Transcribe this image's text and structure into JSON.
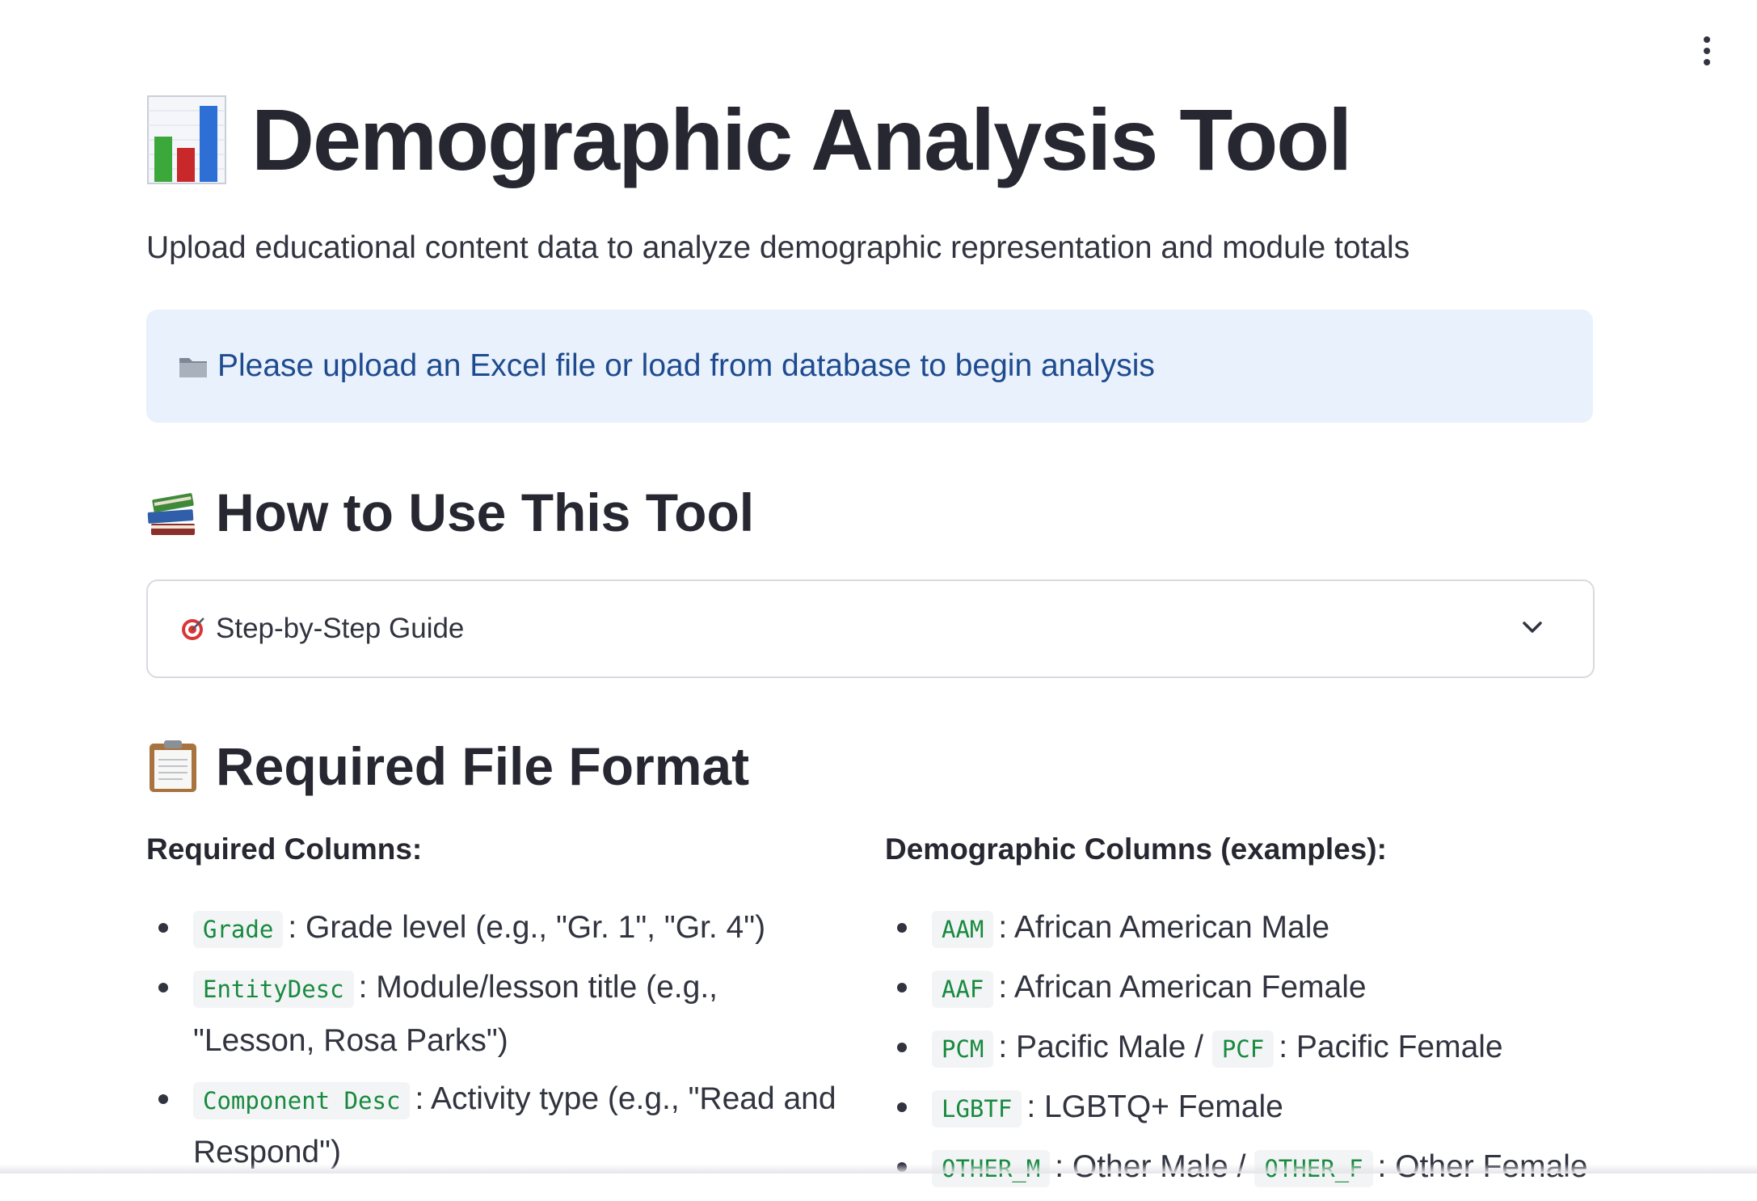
{
  "header": {
    "title": "Demographic Analysis Tool",
    "title_icon": "bar-chart-icon",
    "subtitle": "Upload educational content data to analyze demographic representation and module totals"
  },
  "info_box": {
    "icon": "folder-icon",
    "message": "Please upload an Excel file or load from database to begin analysis"
  },
  "how_to": {
    "icon": "books-icon",
    "heading": "How to Use This Tool",
    "expander": {
      "icon": "target-icon",
      "label": "Step-by-Step Guide"
    }
  },
  "file_format": {
    "icon": "clipboard-icon",
    "heading": "Required File Format",
    "required_columns": {
      "heading": "Required Columns:",
      "items": [
        {
          "code": "Grade",
          "text": ": Grade level (e.g., \"Gr. 1\", \"Gr. 4\")"
        },
        {
          "code": "EntityDesc",
          "text": ": Module/lesson title (e.g., \"Lesson, Rosa Parks\")"
        },
        {
          "code": "Component Desc",
          "text": ": Activity type (e.g., \"Read and Respond\")"
        }
      ]
    },
    "demographic_columns": {
      "heading": "Demographic Columns (examples):",
      "items": [
        {
          "code": "AAM",
          "text": ": African American Male"
        },
        {
          "code": "AAF",
          "text": ": African American Female"
        },
        {
          "code": "PCM",
          "text": ": Pacific Male / ",
          "code2": "PCF",
          "text2": ": Pacific Female"
        },
        {
          "code": "LGBTF",
          "text": ": LGBTQ+ Female"
        },
        {
          "code": "OTHER_M",
          "text": ": Other Male / ",
          "code2": "OTHER_F",
          "text2": ": Other Female"
        }
      ]
    }
  },
  "colors": {
    "accent_text": "#1e4b8f",
    "info_bg": "#e9f1fc",
    "code_text": "#178a3e"
  }
}
